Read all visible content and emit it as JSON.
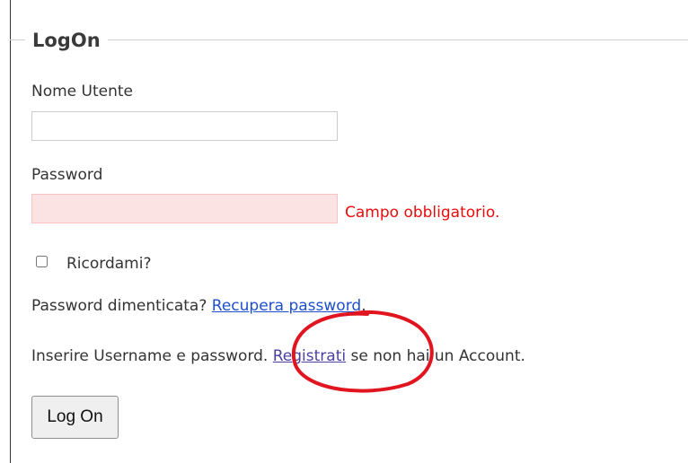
{
  "form": {
    "legend": "LogOn",
    "username": {
      "label": "Nome Utente",
      "value": "",
      "placeholder": ""
    },
    "password": {
      "label": "Password",
      "value": "",
      "placeholder": "",
      "error": "Campo obbligatorio."
    },
    "remember": {
      "label": "Ricordami?",
      "checked": false
    },
    "forgot": {
      "prefix": "Password dimenticata? ",
      "link": "Recupera password",
      "suffix": "."
    },
    "register": {
      "prefix": "Inserire Username e password. ",
      "link": "Registrati",
      "suffix": " se non hai un Account."
    },
    "submit_label": "Log On"
  },
  "colors": {
    "error_text": "#e80c0c",
    "error_field_bg": "#fbe3e4",
    "link": "#1e4fcc",
    "visited_link": "#4b3fa0",
    "annotation": "#e0151f"
  },
  "icons": {
    "annotation": "red-ellipse-annotation"
  }
}
